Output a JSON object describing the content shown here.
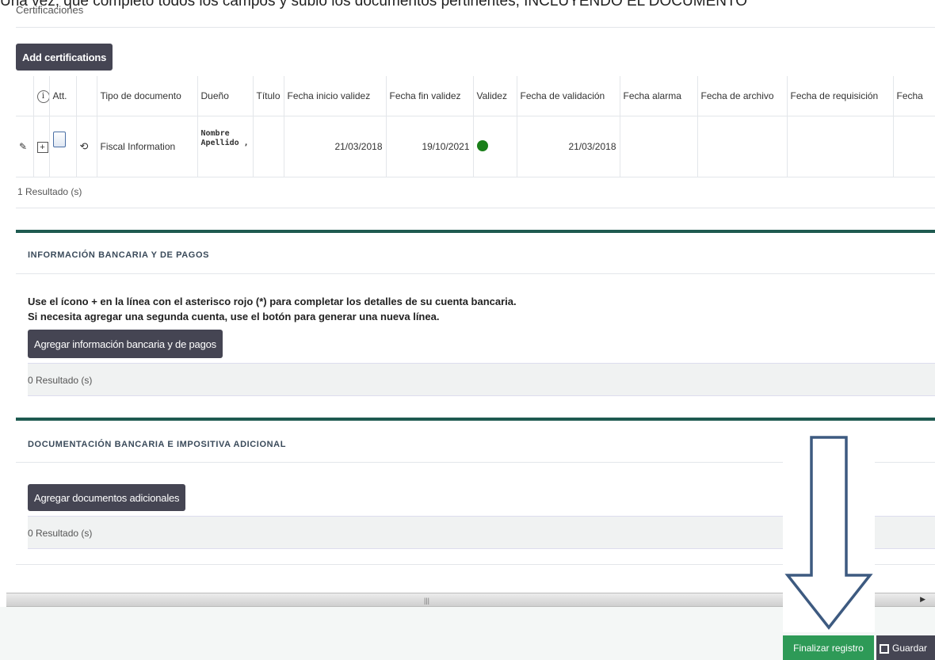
{
  "caption": "Una vez, que completo todos los campos y subio los documentos pertinentes, INCLUYENDO EL DOCUMENTO",
  "certifications": {
    "title": "Certificaciones",
    "add_button": "Add certifications",
    "headers": [
      "",
      "ⓘ",
      "Att.",
      "",
      "Tipo de documento",
      "Dueño",
      "Título",
      "Fecha inicio validez",
      "Fecha fin validez",
      "Validez",
      "Fecha de validación",
      "Fecha alarma",
      "Fecha de archivo",
      "Fecha de requisición",
      "Fecha"
    ],
    "row": {
      "doc_type": "Fiscal Information",
      "owner_line1": "Nombre",
      "owner_line2": "Apellido ,",
      "start": "21/03/2018",
      "end": "19/10/2021",
      "validation_date": "21/03/2018",
      "validity_color": "#1a7f1a"
    },
    "results": "1 Resultado (s)"
  },
  "banking": {
    "title": "INFORMACIÓN BANCARIA Y DE PAGOS",
    "instr1": "Use el ícono + en la línea con el asterisco rojo (*) para completar los detalles de su cuenta bancaria.",
    "instr2": "Si necesita agregar una segunda cuenta, use el botón para generar una nueva línea.",
    "add_button": "Agregar información bancaria y de pagos",
    "results": "0 Resultado (s)"
  },
  "additional_docs": {
    "title": "DOCUMENTACIÓN BANCARIA E IMPOSITIVA ADICIONAL",
    "add_button": "Agregar documentos adicionales",
    "results": "0 Resultado (s)"
  },
  "footer": {
    "finish_button": "Finalizar registro",
    "save_button": "Guardar"
  },
  "colors": {
    "section_accent": "#1e5a50",
    "dark_button": "#454553",
    "finish_green": "#2e9a57",
    "arrow": "#3d5a80"
  }
}
